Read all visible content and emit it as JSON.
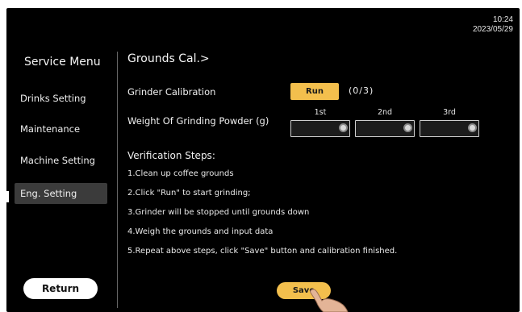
{
  "status": {
    "time": "10:24",
    "date": "2023/05/29"
  },
  "sidebar": {
    "title": "Service Menu",
    "items": [
      {
        "label": "Drinks Setting"
      },
      {
        "label": "Maintenance"
      },
      {
        "label": "Machine Setting"
      },
      {
        "label": "Eng. Setting",
        "active": true
      }
    ],
    "return_label": "Return"
  },
  "page": {
    "title": "Grounds Cal.>",
    "grinder_calibration": {
      "label": "Grinder Calibration",
      "run_label": "Run",
      "count": "(0/3)"
    },
    "weight": {
      "label": "Weight Of Grinding Powder (g)",
      "columns": [
        "1st",
        "2nd",
        "3rd"
      ],
      "values": [
        "",
        "",
        ""
      ]
    },
    "verification": {
      "title": "Verification Steps:",
      "steps": [
        "1.Clean up coffee grounds",
        "2.Click \"Run\" to start grinding;",
        "3.Grinder will be stopped until grounds down",
        "4.Weigh the grounds and input data",
        "5.Repeat above steps, click \"Save\" button and calibration finished."
      ]
    },
    "save_label": "Save"
  },
  "colors": {
    "background": "#000000",
    "accent": "#f3bf4d",
    "active_item": "#3b3b3b"
  }
}
